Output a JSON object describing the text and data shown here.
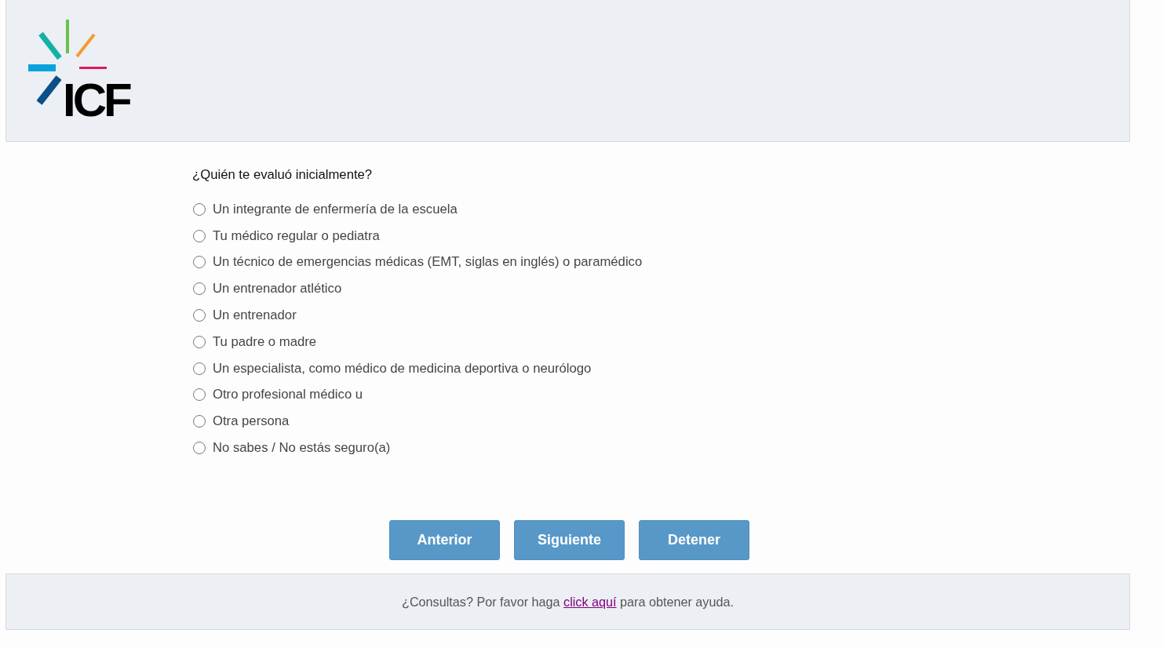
{
  "header": {
    "logo_text": "ICF"
  },
  "question": {
    "text": "¿Quién te evaluó inicialmente?",
    "options": [
      {
        "label": "Un integrante de enfermería de la escuela",
        "selected": false
      },
      {
        "label": "Tu médico regular o pediatra",
        "selected": false
      },
      {
        "label": "Un técnico de emergencias médicas (EMT, siglas en inglés) o paramédico",
        "selected": false
      },
      {
        "label": "Un entrenador atlético",
        "selected": false
      },
      {
        "label": "Un entrenador",
        "selected": false
      },
      {
        "label": "Tu padre o madre",
        "selected": false
      },
      {
        "label": "Un especialista, como médico de medicina deportiva o neurólogo",
        "selected": false
      },
      {
        "label": "Otro profesional médico u",
        "selected": false
      },
      {
        "label": "Otra persona",
        "selected": false
      },
      {
        "label": "No sabes / No estás seguro(a)",
        "selected": false
      }
    ]
  },
  "buttons": [
    "Anterior",
    "Siguiente",
    "Detener"
  ],
  "footer": {
    "text_before": "¿Consultas? Por favor haga",
    "link": "click aquí",
    "text_after": "para obtener ayuda."
  }
}
